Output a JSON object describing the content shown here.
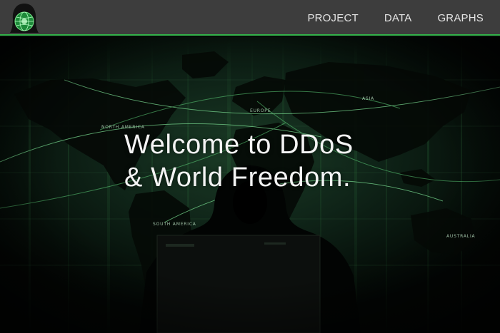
{
  "nav": {
    "logo_icon": "hooded-hacker-globe-logo",
    "links": [
      {
        "label": "PROJECT"
      },
      {
        "label": "DATA"
      },
      {
        "label": "GRAPHS"
      }
    ]
  },
  "hero": {
    "title_line1": "Welcome to DDoS",
    "title_line2": "& World Freedom.",
    "map_labels": {
      "north_america": "NORTH AMERICA",
      "europe": "EUROPE",
      "asia": "ASIA",
      "south_america": "SOUTH AMERICA",
      "australia": "AUSTRALIA"
    }
  },
  "colors": {
    "navbar_bg": "#3d3d3d",
    "accent_green": "#33b24a",
    "hero_bg": "#0f2418",
    "text": "#f4f4f4"
  }
}
